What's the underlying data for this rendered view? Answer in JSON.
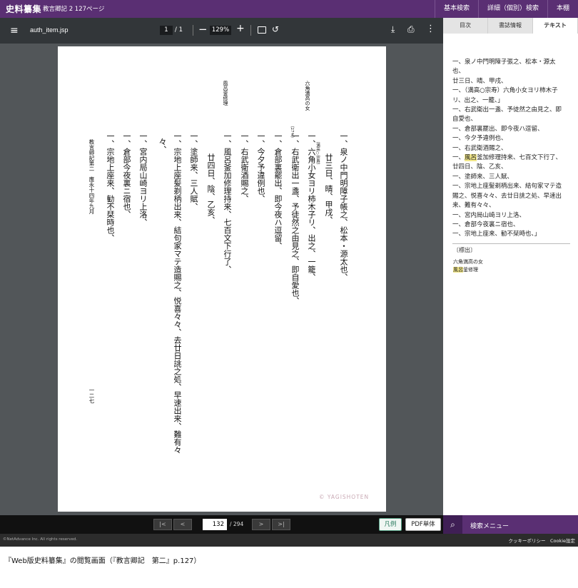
{
  "header": {
    "brand": "史料纂集",
    "subtitle": "教言卿記 2  127ページ",
    "nav": [
      "基本検索",
      "詳細（個別）検索",
      "本棚"
    ]
  },
  "pdf_toolbar": {
    "filename": "auth_item.jsp",
    "page_current": "1",
    "page_total": "/ 1",
    "zoom": "129%"
  },
  "document": {
    "columns": [
      {
        "text": "一、泉ノ中門明障子帳之、松本・源太也、",
        "note": ""
      },
      {
        "text": "廿三日、晴、甲戌、",
        "note": ""
      },
      {
        "text": "一、六角小女ヨリ柿木子リ、出之、一籠、",
        "note": "（満高○宗寿）"
      },
      {
        "text": "一、右武衛出一盞、予徒然之由見之、即自愛也、",
        "note": "（27オ）"
      },
      {
        "text": "一、倉部裏罷出、即今夜ハ逗留、",
        "note": ""
      },
      {
        "text": "一、今夕予違例也、",
        "note": ""
      },
      {
        "text": "一、右武衛酒賜之、",
        "note": ""
      },
      {
        "text": "一、風呂釜加修理持来、七百文下行了、",
        "note": ""
      },
      {
        "text": "廿四日、陰、乙亥、",
        "note": ""
      },
      {
        "text": "一、塗師来、三人賦、",
        "note": ""
      },
      {
        "text": "一、宗地上座髪剃柄出来、結句家マテ造賜之、悦喜々々、去廿日誂之処、早速出来、難有々",
        "note": ""
      },
      {
        "text": "々、",
        "note": ""
      },
      {
        "text": "一、宮内局山崎ヨリ上洛、",
        "note": ""
      },
      {
        "text": "一、倉部今夜裏ニ宿也、",
        "note": ""
      },
      {
        "text": "一、宗地上座来、勧不栞時也、",
        "note": ""
      }
    ],
    "headings": [
      "六角満高の女",
      "風呂釜修理"
    ],
    "running_head": "教言卿記第二　應永十四年九月",
    "page_number": "一二七",
    "watermark": "© YAGISHOTEN"
  },
  "bottom_nav": {
    "first": "|<",
    "prev": "<",
    "page": "132",
    "total": "/ 294",
    "next": ">",
    "last": ">|",
    "legend": "凡例",
    "pdf": "PDF単体"
  },
  "side_panel": {
    "tabs": [
      "目次",
      "書誌情報",
      "テキスト"
    ],
    "active_tab": "テキスト",
    "text_lines": [
      "一、泉ノ中門明障子張之、松本・源太",
      "也、",
      "廿三日、晴、甲戌、",
      "一、（満高○宗寿）六角小女ヨリ柿木子",
      "リ、出之、一籠、」",
      "一、右武衛出一盞、予徒然之由見之、即",
      "自愛也、",
      "一、倉部裏罷出、即今夜ハ逗留、",
      "一、今夕予違例也、",
      "一、右武衛酒賜之、",
      "一、[風呂]釜加修理持来、七百文下行了、",
      "廿四日、陰、乙亥、",
      "一、塗師来、三人賦、",
      "一、宗地上座髪剃柄出来、結句家マテ造",
      "賜之、悦喜々々、去廿日誂之処、早速出",
      "来、難有々々、",
      "一、宮内局山崎ヨリ上洛、",
      "一、倉部今夜裏ニ宿也、",
      "一、宗地上座来、勧不栞時也、」"
    ],
    "heading_label": "〔標出〕",
    "heading_items": [
      "六角満高の女",
      "風呂釜修理"
    ],
    "highlight_term": "風呂",
    "search_menu": "検索メニュー"
  },
  "footer": {
    "copyright": "©NetAdvance Inc. All rights reserved.",
    "links": "クッキーポリシー　Cookie設定"
  },
  "caption": "『Web版史料纂集』の閲覧画面（『教言卿記　第二』p.127）",
  "colors": {
    "brand_purple": "#5a2f73",
    "highlight": "#f3e88a",
    "legend_green": "#2a7a5e"
  },
  "icons": [
    "hamburger-menu-icon",
    "fit-page-icon",
    "rotate-icon",
    "download-icon",
    "print-icon",
    "more-vert-icon",
    "search-icon"
  ]
}
